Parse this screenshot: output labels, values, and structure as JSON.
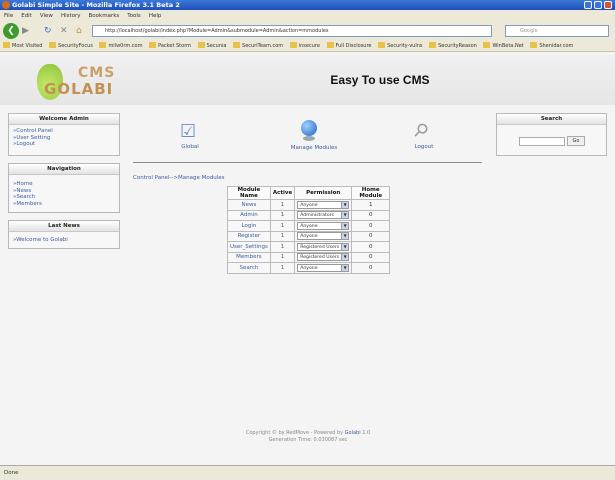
{
  "browser": {
    "title": "Golabi Simple Site - Mozilla Firefox 3.1 Beta 2",
    "menu": [
      "File",
      "Edit",
      "View",
      "History",
      "Bookmarks",
      "Tools",
      "Help"
    ],
    "url": "http://localhost/golabi/index.php?Module=Admin&submodule=Admin&action=mmodules",
    "search_placeholder": "Google",
    "bookmarks": [
      "Most Visited",
      "SecurityFocus",
      "milw0rm.com",
      "Packet Storm",
      "Secunia",
      "SecuriTeam.com",
      "insecure",
      "Full Disclosure",
      "Security-vulns",
      "SecurityReason",
      "WinBeta.Net",
      "Shenidar.com"
    ],
    "status": "Done"
  },
  "site": {
    "logo_top": "CMS",
    "logo_bottom": "GOLABI",
    "title": "Easy To use CMS"
  },
  "welcome": {
    "title": "Welcome Admin",
    "links": [
      "»Control Panel",
      "»User Setting",
      "»Logout"
    ]
  },
  "navigation": {
    "title": "Navigation",
    "links": [
      "»Home",
      "»News",
      "»Search",
      "»Members"
    ]
  },
  "last_news": {
    "title": "Last News",
    "links": [
      "»Welcome to Golabi"
    ]
  },
  "search": {
    "title": "Search",
    "button": "Go",
    "value": ""
  },
  "admin_nav": [
    {
      "label": "Global",
      "icon": "checklist-icon"
    },
    {
      "label": "Manage Modules",
      "icon": "globe-icon"
    },
    {
      "label": "Logout",
      "icon": "key-icon"
    }
  ],
  "breadcrumb": "Control Panel-->Manage Modules",
  "table": {
    "headers": [
      "Module Name",
      "Active",
      "Permission",
      "Home Module"
    ],
    "rows": [
      [
        "News",
        "1",
        "Anyone",
        "1"
      ],
      [
        "Admin",
        "1",
        "Administrators",
        "0"
      ],
      [
        "Login",
        "1",
        "Anyone",
        "0"
      ],
      [
        "Register",
        "1",
        "Anyone",
        "0"
      ],
      [
        "User_Settings",
        "1",
        "Registered Users",
        "0"
      ],
      [
        "Members",
        "1",
        "Registered Users",
        "0"
      ],
      [
        "Search",
        "1",
        "Anyone",
        "0"
      ]
    ]
  },
  "footer": {
    "copyright": "Copyright © by RedMove - Powered by",
    "link": "Golabi",
    "version": "1.0",
    "generation": "Generation Time: 0.030087 sec"
  }
}
